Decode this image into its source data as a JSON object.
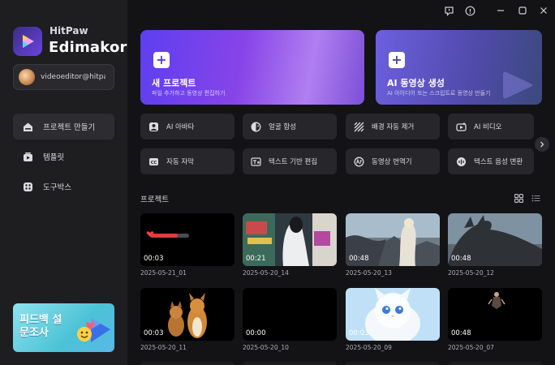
{
  "brand": {
    "top": "HitPaw",
    "main": "Edimakor"
  },
  "account": {
    "name": "videoeditor@hitpa..."
  },
  "nav": [
    {
      "label": "프로젝트 만들기",
      "icon": "home-icon"
    },
    {
      "label": "템플릿",
      "icon": "template-icon"
    },
    {
      "label": "도구박스",
      "icon": "toolbox-icon"
    }
  ],
  "promo": {
    "text": "피드백 설문조사"
  },
  "hero": {
    "new": {
      "title": "새 프로젝트",
      "sub": "파일 추가하고 동영상 편집하기"
    },
    "ai": {
      "title": "AI 동영상 생성",
      "sub": "AI 아이디어 또는 스크립트로 동영상 만들기"
    }
  },
  "tools": [
    {
      "label": "AI 아바타",
      "icon": "avatar-icon"
    },
    {
      "label": "얼굴 합성",
      "icon": "face-swap-icon"
    },
    {
      "label": "배경 자동 제거",
      "icon": "background-remove-icon"
    },
    {
      "label": "AI 비디오",
      "icon": "ai-video-icon"
    },
    {
      "label": "자동 자막",
      "icon": "subtitle-icon"
    },
    {
      "label": "텍스트 기반 편집",
      "icon": "text-edit-icon"
    },
    {
      "label": "동영상 번역기",
      "icon": "translate-icon"
    },
    {
      "label": "텍스트 음성 변환",
      "icon": "text-to-speech-icon"
    }
  ],
  "projects_title": "프로젝트",
  "projects": [
    {
      "duration": "00:03",
      "date": "2025-05-21_01"
    },
    {
      "duration": "00:21",
      "date": "2025-05-20_14"
    },
    {
      "duration": "00:48",
      "date": "2025-05-20_13"
    },
    {
      "duration": "00:48",
      "date": "2025-05-20_12"
    },
    {
      "duration": "00:03",
      "date": "2025-05-20_11"
    },
    {
      "duration": "00:00",
      "date": "2025-05-20_10"
    },
    {
      "duration": "00:03",
      "date": "2025-05-20_09"
    },
    {
      "duration": "00:48",
      "date": "2025-05-20_07"
    }
  ],
  "colors": {
    "accent": "#6b43e0",
    "background": "#131316",
    "sidebar": "#1e1e21"
  }
}
